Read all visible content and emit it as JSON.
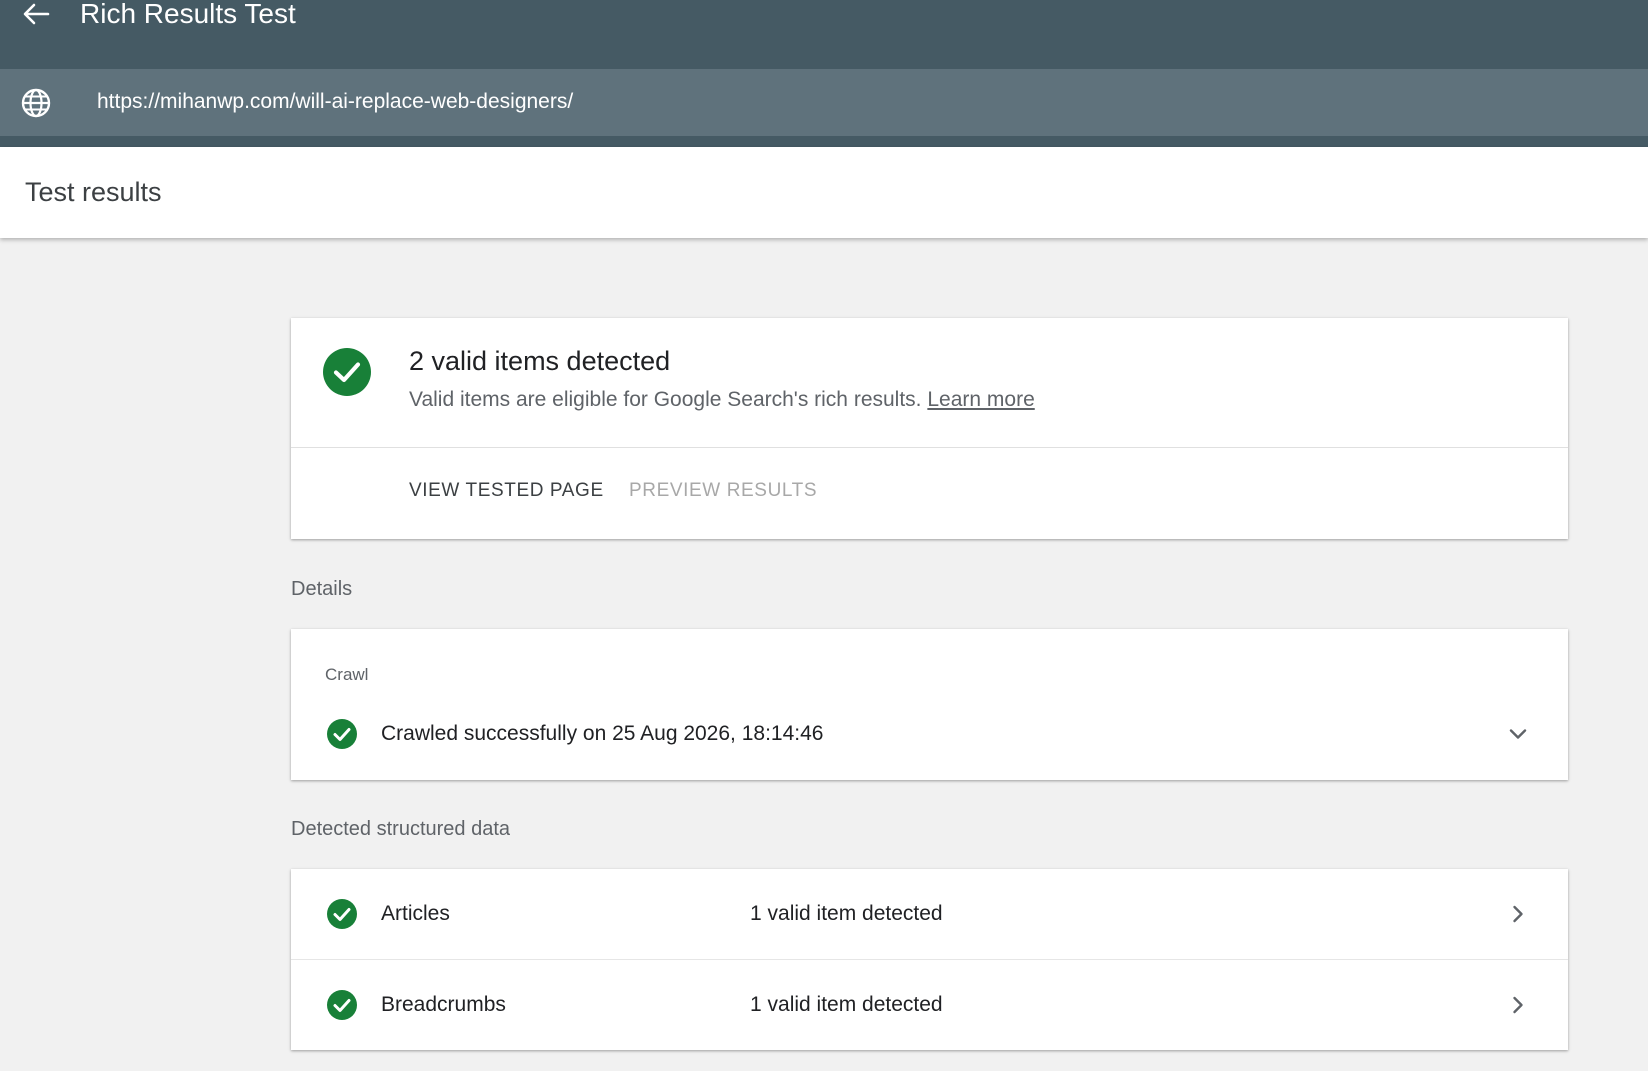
{
  "header": {
    "app_title": "Rich Results Test",
    "back_icon": "arrow-back-icon"
  },
  "url_bar": {
    "icon": "globe-icon",
    "url": "https://mihanwp.com/will-ai-replace-web-designers/"
  },
  "results": {
    "title": "Test results"
  },
  "summary": {
    "title": "2 valid items detected",
    "description": "Valid items are eligible for Google Search's rich results.",
    "learn_more": "Learn more",
    "tabs": {
      "view_tested_page": "VIEW TESTED PAGE",
      "preview_results": "PREVIEW RESULTS"
    }
  },
  "details": {
    "section_label": "Details",
    "crawl": {
      "label": "Crawl",
      "status_text": "Crawled successfully on 25 Aug 2026, 18:14:46"
    }
  },
  "structured_data": {
    "section_label": "Detected structured data",
    "items": [
      {
        "name": "Articles",
        "status": "1 valid item detected"
      },
      {
        "name": "Breadcrumbs",
        "status": "1 valid item detected"
      }
    ]
  },
  "colors": {
    "header_bg": "#455a64",
    "url_bar_bg": "#5f727c",
    "success_green": "#188038",
    "page_bg": "#f1f1f1"
  }
}
